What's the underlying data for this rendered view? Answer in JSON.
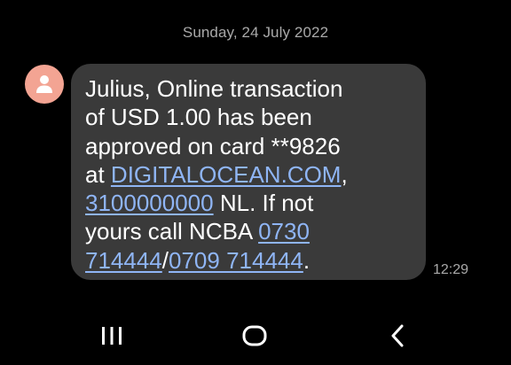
{
  "conversation": {
    "date_header": "Sunday, 24 July 2022"
  },
  "message": {
    "avatar_icon": "person-icon",
    "avatar_color": "#f3a493",
    "bubble_color": "#3a3a3a",
    "link_color": "#8fb5f5",
    "line1": "Julius, Online transaction",
    "line2": "of USD 1.00 has been",
    "line3": "approved on card **9826",
    "line4_prefix": "at ",
    "link_domain": "DIGITALOCEAN.COM",
    "line4_suffix": ",",
    "link_number": "3100000000",
    "line5_suffix": " NL. If not",
    "line6_prefix": "yours call NCBA ",
    "link_phone1_part1": "0730",
    "link_phone1_part2": "714444",
    "separator": "/",
    "link_phone2": "0709 714444",
    "end": ".",
    "timestamp": "12:29"
  },
  "navbar": {
    "recent_icon": "recent-apps-icon",
    "home_icon": "home-icon",
    "back_icon": "back-icon"
  }
}
